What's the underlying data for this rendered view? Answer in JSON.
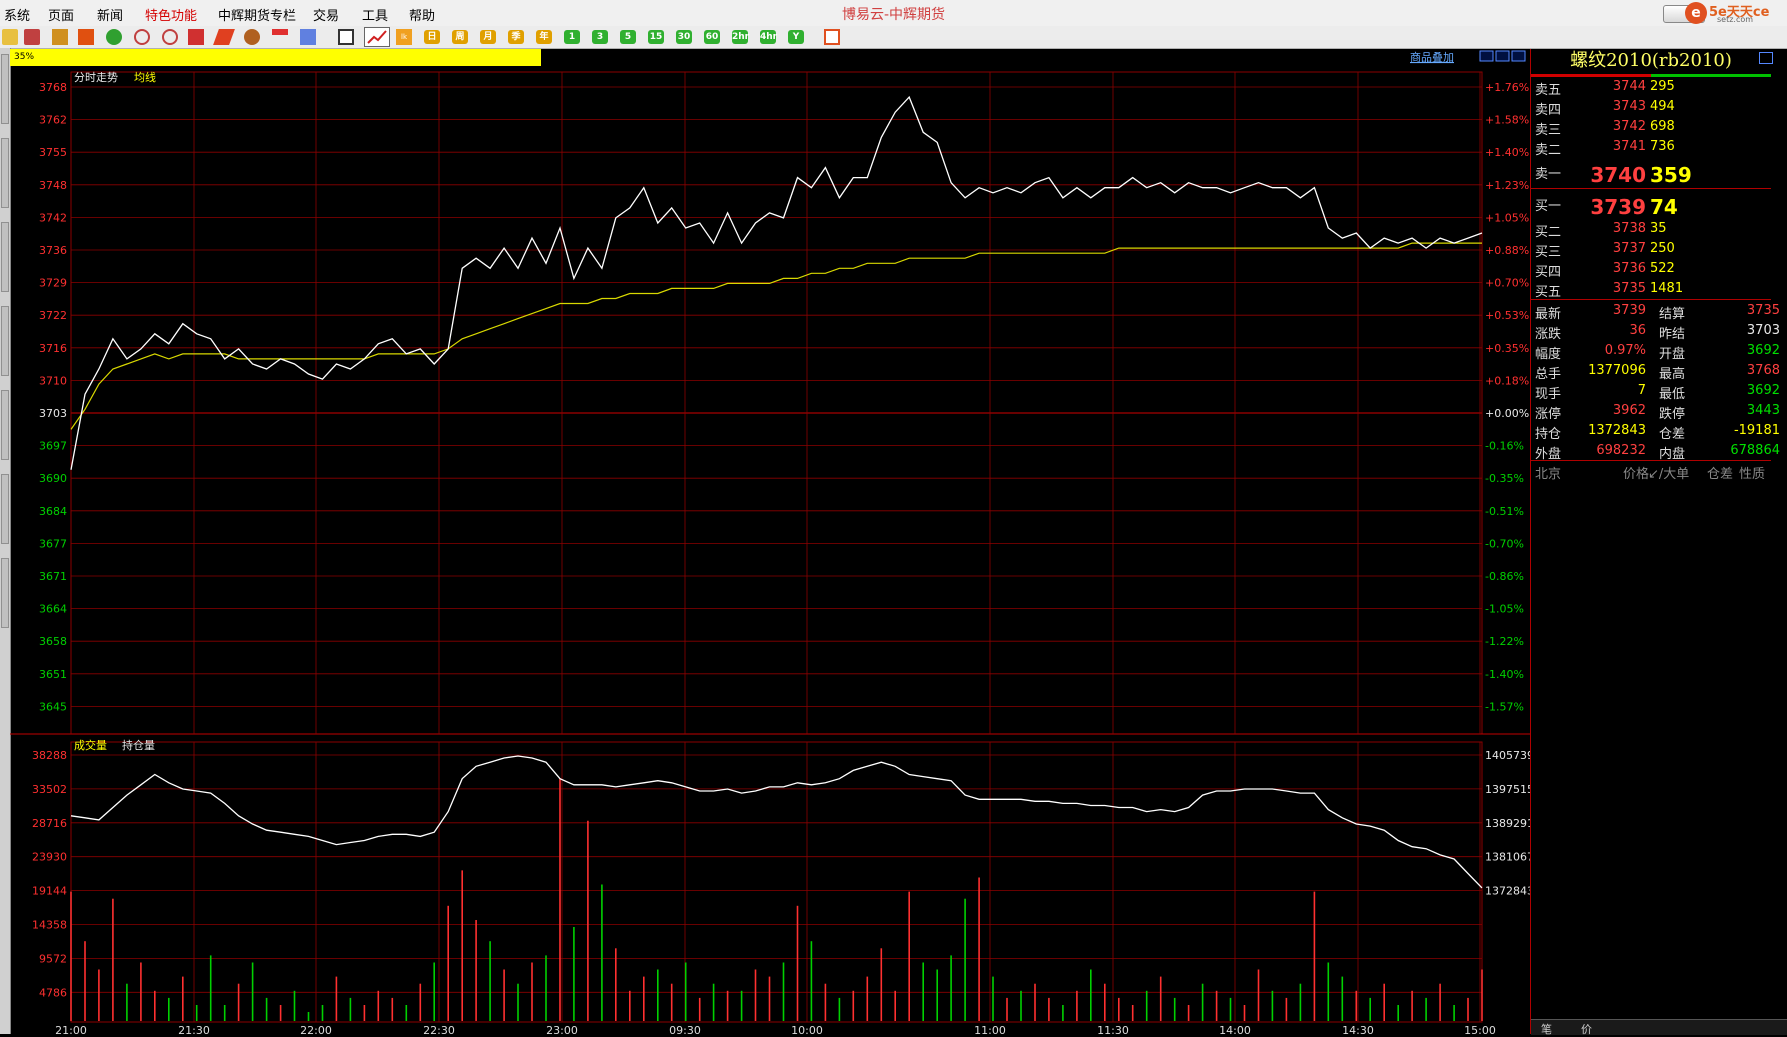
{
  "app_title": "博易云-中辉期货",
  "logo_text": "5e天天ce",
  "logo_sub": "setz.com",
  "menu": [
    "系统",
    "页面",
    "新闻",
    "特色功能",
    "中辉期货专栏",
    "交易",
    "工具",
    "帮助"
  ],
  "toolbar_period_buttons": [
    "日",
    "周",
    "月",
    "季",
    "年",
    "1",
    "3",
    "5",
    "15",
    "30",
    "60",
    "2hr",
    "4hr",
    "Y"
  ],
  "progress_text": "35%",
  "chart_header": {
    "left_label": "分时走势",
    "avg_label": "均线",
    "overlay_link": "商品叠加"
  },
  "volume_header": {
    "volume_label": "成交量",
    "oi_label": "持仓量"
  },
  "colors": {
    "price_line": "#ffffff",
    "avg_line": "#d8d800",
    "grid": "#8b0000",
    "up": "#ff3030",
    "down": "#00d000"
  },
  "chart_data": {
    "type": "line",
    "price_ticks": [
      "3768",
      "3762",
      "3755",
      "3748",
      "3742",
      "3736",
      "3729",
      "3722",
      "3716",
      "3710",
      "3703",
      "3697",
      "3690",
      "3684",
      "3677",
      "3671",
      "3664",
      "3658",
      "3651",
      "3645"
    ],
    "pct_ticks": [
      "+1.76%",
      "+1.58%",
      "+1.40%",
      "+1.23%",
      "+1.05%",
      "+0.88%",
      "+0.70%",
      "+0.53%",
      "+0.35%",
      "+0.18%",
      "+0.00%",
      "-0.16%",
      "-0.35%",
      "-0.51%",
      "-0.70%",
      "-0.86%",
      "-1.05%",
      "-1.22%",
      "-1.40%",
      "-1.57%"
    ],
    "ylim": [
      3641,
      3770
    ],
    "prev_settle": 3703,
    "time_ticks": [
      "21:00",
      "21:30",
      "22:00",
      "22:30",
      "23:00",
      "09:30",
      "10:00",
      "11:00",
      "11:30",
      "14:00",
      "14:30",
      "15:00"
    ],
    "price": [
      3692,
      3707,
      3712,
      3718,
      3714,
      3716,
      3719,
      3717,
      3721,
      3719,
      3718,
      3714,
      3716,
      3713,
      3712,
      3714,
      3713,
      3711,
      3710,
      3713,
      3712,
      3714,
      3717,
      3718,
      3715,
      3716,
      3713,
      3716,
      3732,
      3734,
      3732,
      3736,
      3732,
      3738,
      3733,
      3740,
      3730,
      3736,
      3732,
      3742,
      3744,
      3748,
      3741,
      3744,
      3740,
      3741,
      3737,
      3743,
      3737,
      3741,
      3743,
      3742,
      3750,
      3748,
      3752,
      3746,
      3750,
      3750,
      3758,
      3763,
      3766,
      3759,
      3757,
      3749,
      3746,
      3748,
      3747,
      3748,
      3747,
      3749,
      3750,
      3746,
      3748,
      3746,
      3748,
      3748,
      3750,
      3748,
      3749,
      3747,
      3749,
      3748,
      3748,
      3747,
      3748,
      3749,
      3748,
      3748,
      3746,
      3748,
      3740,
      3738,
      3739,
      3736,
      3738,
      3737,
      3738,
      3736,
      3738,
      3737,
      3738,
      3739
    ],
    "avg": [
      3700,
      3704,
      3709,
      3712,
      3713,
      3714,
      3715,
      3714,
      3715,
      3715,
      3715,
      3715,
      3714,
      3714,
      3714,
      3714,
      3714,
      3714,
      3714,
      3714,
      3714,
      3714,
      3715,
      3715,
      3715,
      3715,
      3715,
      3716,
      3718,
      3719,
      3720,
      3721,
      3722,
      3723,
      3724,
      3725,
      3725,
      3725,
      3726,
      3726,
      3727,
      3727,
      3727,
      3728,
      3728,
      3728,
      3728,
      3729,
      3729,
      3729,
      3729,
      3730,
      3730,
      3731,
      3731,
      3732,
      3732,
      3733,
      3733,
      3733,
      3734,
      3734,
      3734,
      3734,
      3734,
      3735,
      3735,
      3735,
      3735,
      3735,
      3735,
      3735,
      3735,
      3735,
      3735,
      3736,
      3736,
      3736,
      3736,
      3736,
      3736,
      3736,
      3736,
      3736,
      3736,
      3736,
      3736,
      3736,
      3736,
      3736,
      3736,
      3736,
      3736,
      3736,
      3736,
      3736,
      3737,
      3737,
      3737,
      3737,
      3737,
      3737
    ],
    "volume_ticks": [
      "38288",
      "33502",
      "28716",
      "23930",
      "19144",
      "14358",
      "9572",
      "4786"
    ],
    "oi_ticks": [
      "1405739",
      "1397515",
      "1389291",
      "1381067",
      "1372843"
    ],
    "oi_ylim": [
      1371000,
      1407500
    ],
    "open_interest": [
      1391000,
      1390500,
      1390000,
      1393000,
      1396000,
      1398500,
      1401000,
      1399000,
      1397500,
      1397000,
      1396500,
      1394000,
      1391000,
      1389000,
      1387500,
      1387000,
      1386500,
      1386000,
      1385000,
      1384000,
      1384500,
      1385000,
      1386000,
      1386500,
      1386500,
      1386000,
      1387000,
      1392000,
      1400000,
      1403000,
      1404000,
      1405000,
      1405500,
      1405000,
      1404000,
      1400000,
      1398500,
      1398500,
      1398500,
      1398000,
      1398500,
      1399000,
      1399500,
      1399000,
      1398000,
      1397000,
      1397000,
      1397500,
      1396500,
      1397000,
      1398000,
      1398000,
      1399000,
      1398500,
      1399000,
      1400000,
      1402000,
      1403000,
      1404000,
      1403000,
      1401000,
      1400500,
      1400000,
      1399500,
      1396000,
      1395000,
      1395000,
      1395000,
      1395000,
      1394500,
      1394500,
      1394000,
      1394000,
      1393500,
      1393500,
      1393000,
      1393000,
      1392000,
      1392500,
      1392000,
      1393000,
      1396000,
      1397000,
      1397000,
      1397500,
      1397500,
      1397500,
      1397000,
      1396500,
      1396500,
      1392500,
      1390500,
      1389000,
      1388500,
      1387500,
      1385000,
      1383500,
      1383000,
      1381500,
      1380500,
      1377000,
      1373500
    ],
    "volume": [
      19000,
      12000,
      8000,
      18000,
      6000,
      9000,
      5000,
      4000,
      7000,
      3000,
      10000,
      3000,
      6000,
      9000,
      4000,
      3000,
      5000,
      2000,
      3000,
      7000,
      4000,
      3000,
      5000,
      4000,
      3000,
      6000,
      9000,
      17000,
      22000,
      15000,
      12000,
      8000,
      6000,
      9000,
      10000,
      35000,
      14000,
      29000,
      20000,
      11000,
      5000,
      7000,
      8000,
      6000,
      9000,
      4000,
      6000,
      5000,
      5000,
      8000,
      7000,
      9000,
      17000,
      12000,
      6000,
      4000,
      5000,
      7000,
      11000,
      5000,
      19000,
      9000,
      8000,
      10000,
      18000,
      21000,
      7000,
      4000,
      5000,
      6000,
      4000,
      3000,
      5000,
      8000,
      6000,
      4000,
      3000,
      5000,
      7000,
      4000,
      3000,
      6000,
      5000,
      4000,
      3000,
      8000,
      5000,
      4000,
      6000,
      19000,
      9000,
      7000,
      5000,
      4000,
      6000,
      3000,
      5000,
      4000,
      6000,
      3000,
      4000,
      8000
    ]
  },
  "quote": {
    "title": "螺纹2010(rb2010)",
    "asks": [
      {
        "label": "卖五",
        "price": "3744",
        "vol": "295"
      },
      {
        "label": "卖四",
        "price": "3743",
        "vol": "494"
      },
      {
        "label": "卖三",
        "price": "3742",
        "vol": "698"
      },
      {
        "label": "卖二",
        "price": "3741",
        "vol": "736"
      },
      {
        "label": "卖一",
        "price": "3740",
        "vol": "359"
      }
    ],
    "bids": [
      {
        "label": "买一",
        "price": "3739",
        "vol": "74"
      },
      {
        "label": "买二",
        "price": "3738",
        "vol": "35"
      },
      {
        "label": "买三",
        "price": "3737",
        "vol": "250"
      },
      {
        "label": "买四",
        "price": "3736",
        "vol": "522"
      },
      {
        "label": "买五",
        "price": "3735",
        "vol": "1481"
      }
    ],
    "stats": [
      {
        "l1": "最新",
        "v1": "3739",
        "c1": "red",
        "l2": "结算",
        "v2": "3735",
        "c2": "red"
      },
      {
        "l1": "涨跌",
        "v1": "36",
        "c1": "red",
        "l2": "昨结",
        "v2": "3703",
        "c2": "white"
      },
      {
        "l1": "幅度",
        "v1": "0.97%",
        "c1": "red",
        "l2": "开盘",
        "v2": "3692",
        "c2": "green"
      },
      {
        "l1": "总手",
        "v1": "1377096",
        "c1": "yellow",
        "l2": "最高",
        "v2": "3768",
        "c2": "red"
      },
      {
        "l1": "现手",
        "v1": "7",
        "c1": "yellow",
        "l2": "最低",
        "v2": "3692",
        "c2": "green"
      },
      {
        "l1": "涨停",
        "v1": "3962",
        "c1": "red",
        "l2": "跌停",
        "v2": "3443",
        "c2": "green"
      },
      {
        "l1": "持仓",
        "v1": "1372843",
        "c1": "yellow",
        "l2": "仓差",
        "v2": "-19181",
        "c2": "yellow"
      },
      {
        "l1": "外盘",
        "v1": "698232",
        "c1": "red",
        "l2": "内盘",
        "v2": "678864",
        "c2": "green"
      }
    ],
    "trade_header": {
      "place": "北京",
      "price": "价格",
      "big": "↙/大单",
      "oi_diff": "仓差",
      "nature": "性质"
    },
    "bottom_tabs": [
      "笔",
      "价"
    ]
  }
}
